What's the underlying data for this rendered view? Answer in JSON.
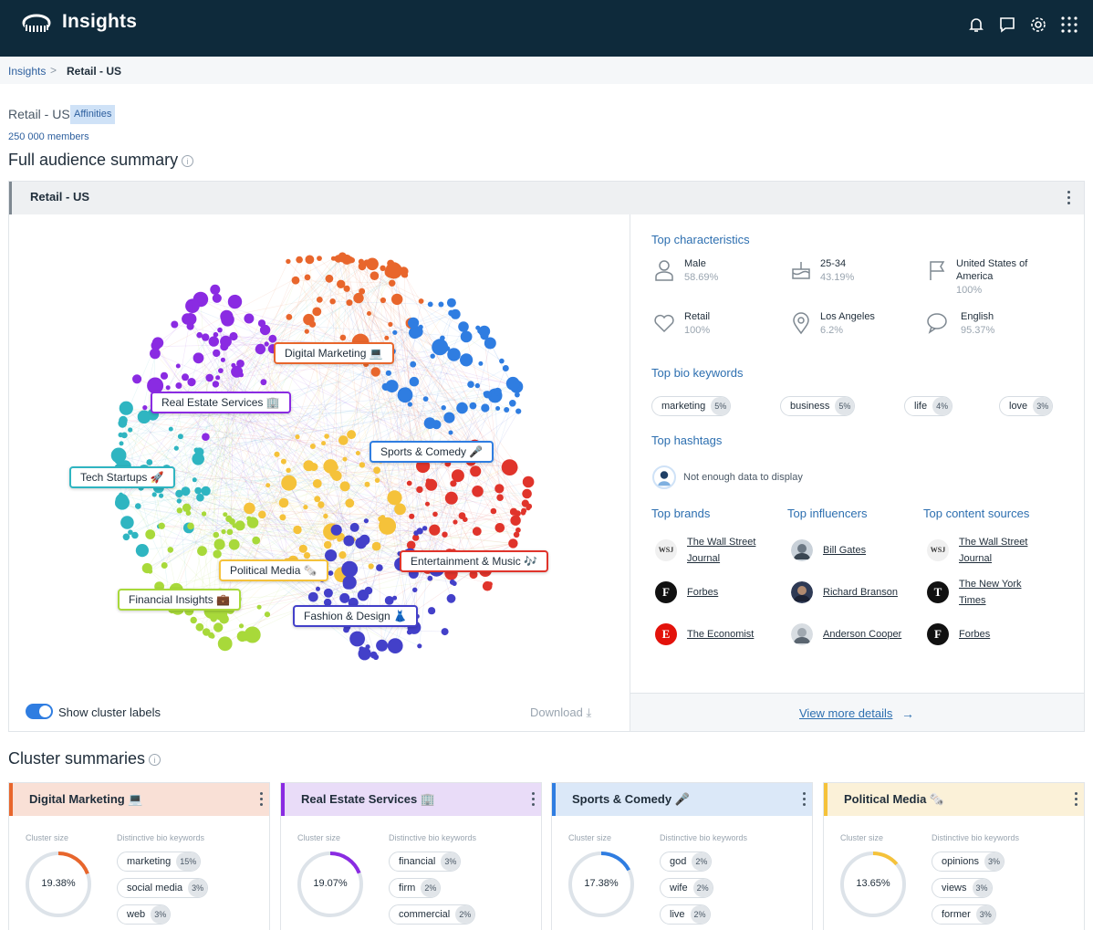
{
  "app": {
    "title": "Insights"
  },
  "breadcrumb": {
    "root": "Insights",
    "separator": ">",
    "current": "Retail - US"
  },
  "audience": {
    "name": "Retail - US",
    "tag": "Affinities",
    "members": "250 000 members"
  },
  "sections": {
    "full_summary": "Full audience summary",
    "cluster_summaries": "Cluster summaries",
    "info": "i"
  },
  "panel": {
    "title": "Retail - US",
    "show_labels": "Show cluster labels",
    "download": "Download",
    "view_more": "View more details",
    "arrow": "→",
    "download_arrow": "⤓"
  },
  "clusters": [
    {
      "label": "Digital Marketing 💻",
      "color": "#e8662c"
    },
    {
      "label": "Real Estate Services 🏢",
      "color": "#8a2be2"
    },
    {
      "label": "Sports & Comedy 🎤",
      "color": "#2f7de1"
    },
    {
      "label": "Tech Startups 🚀",
      "color": "#2fb5c1"
    },
    {
      "label": "Entertainment & Music 🎶",
      "color": "#e0342b"
    },
    {
      "label": "Political Media 🗞️",
      "color": "#f5c23a"
    },
    {
      "label": "Financial Insights 💼",
      "color": "#a8d93a"
    },
    {
      "label": "Fashion & Design 👗",
      "color": "#4340c9"
    }
  ],
  "details": {
    "characteristics_title": "Top characteristics",
    "characteristics": [
      {
        "icon": "person-icon",
        "name": "Male",
        "value": "58.69%"
      },
      {
        "icon": "cake-icon",
        "name": "25-34",
        "value": "43.19%"
      },
      {
        "icon": "flag-icon",
        "name": "United States of America",
        "value": "100%"
      },
      {
        "icon": "heart-icon",
        "name": "Retail",
        "value": "100%"
      },
      {
        "icon": "location-icon",
        "name": "Los Angeles",
        "value": "6.2%"
      },
      {
        "icon": "chat-icon",
        "name": "English",
        "value": "95.37%"
      }
    ],
    "bio_title": "Top bio keywords",
    "bio_keywords": [
      {
        "word": "marketing",
        "pct": "5%"
      },
      {
        "word": "business",
        "pct": "5%"
      },
      {
        "word": "life",
        "pct": "4%"
      },
      {
        "word": "love",
        "pct": "3%"
      }
    ],
    "hashtags_title": "Top hashtags",
    "hashtags_empty": "Not enough data to display",
    "brands_title": "Top brands",
    "brands": [
      {
        "icon": "WSJ",
        "name": "The Wall Street Journal"
      },
      {
        "icon": "F",
        "name": "Forbes"
      },
      {
        "icon": "E",
        "name": "The Economist"
      }
    ],
    "influencers_title": "Top influencers",
    "influencers": [
      {
        "name": "Bill Gates"
      },
      {
        "name": "Richard Branson"
      },
      {
        "name": "Anderson Cooper"
      }
    ],
    "sources_title": "Top content sources",
    "sources": [
      {
        "icon": "WSJ",
        "name": "The Wall Street Journal"
      },
      {
        "icon": "T",
        "name": "The New York Times"
      },
      {
        "icon": "F",
        "name": "Forbes"
      }
    ]
  },
  "cluster_cards": [
    {
      "title": "Digital Marketing 💻",
      "color": "#e8662c",
      "bg": "#f9e0d6",
      "size_label": "Cluster size",
      "size": "19.38%",
      "size_frac": 0.1938,
      "kw_label": "Distinctive bio keywords",
      "keywords": [
        {
          "word": "marketing",
          "pct": "15%"
        },
        {
          "word": "social media",
          "pct": "3%"
        },
        {
          "word": "web",
          "pct": "3%"
        }
      ]
    },
    {
      "title": "Real Estate Services 🏢",
      "color": "#8a2be2",
      "bg": "#e9dcf8",
      "size_label": "Cluster size",
      "size": "19.07%",
      "size_frac": 0.1907,
      "kw_label": "Distinctive bio keywords",
      "keywords": [
        {
          "word": "financial",
          "pct": "3%"
        },
        {
          "word": "firm",
          "pct": "2%"
        },
        {
          "word": "commercial",
          "pct": "2%"
        }
      ]
    },
    {
      "title": "Sports & Comedy 🎤",
      "color": "#2f7de1",
      "bg": "#dbe8f8",
      "size_label": "Cluster size",
      "size": "17.38%",
      "size_frac": 0.1738,
      "kw_label": "Distinctive bio keywords",
      "keywords": [
        {
          "word": "god",
          "pct": "2%"
        },
        {
          "word": "wife",
          "pct": "2%"
        },
        {
          "word": "live",
          "pct": "2%"
        }
      ]
    },
    {
      "title": "Political Media 🗞️",
      "color": "#f5c23a",
      "bg": "#fbf1d8",
      "size_label": "Cluster size",
      "size": "13.65%",
      "size_frac": 0.1365,
      "kw_label": "Distinctive bio keywords",
      "keywords": [
        {
          "word": "opinions",
          "pct": "3%"
        },
        {
          "word": "views",
          "pct": "3%"
        },
        {
          "word": "former",
          "pct": "3%"
        }
      ]
    }
  ]
}
